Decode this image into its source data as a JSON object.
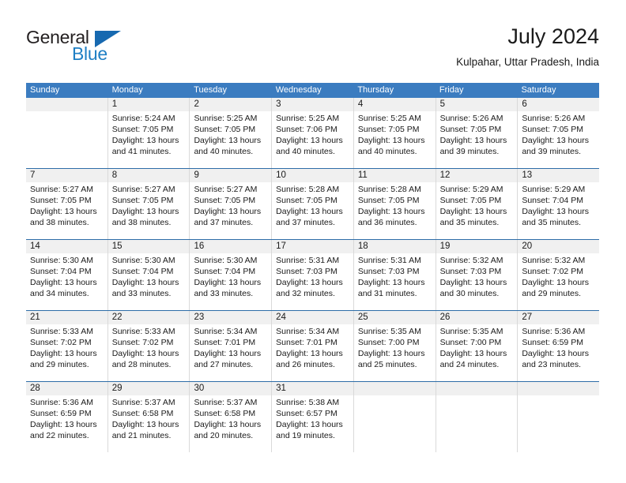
{
  "brand": {
    "name_top": "General",
    "name_bottom": "Blue",
    "color_dark": "#231f20",
    "color_blue": "#1f7fc4"
  },
  "header": {
    "title": "July 2024",
    "subtitle": "Kulpahar, Uttar Pradesh, India"
  },
  "theme": {
    "header_blue": "#3b7cc0",
    "week_divider": "#2e6da8",
    "daynum_band": "#f0f0f0",
    "cell_border": "#d9d9d9"
  },
  "weekdays": [
    "Sunday",
    "Monday",
    "Tuesday",
    "Wednesday",
    "Thursday",
    "Friday",
    "Saturday"
  ],
  "labels": {
    "sunrise_prefix": "Sunrise:",
    "sunset_prefix": "Sunset:",
    "daylight_prefix": "Daylight:"
  },
  "weeks": [
    {
      "days": [
        {
          "num": "",
          "empty": true,
          "sunrise": "",
          "sunset": "",
          "daylight_1": "",
          "daylight_2": ""
        },
        {
          "num": "1",
          "empty": false,
          "sunrise": "Sunrise: 5:24 AM",
          "sunset": "Sunset: 7:05 PM",
          "daylight_1": "Daylight: 13 hours",
          "daylight_2": "and 41 minutes."
        },
        {
          "num": "2",
          "empty": false,
          "sunrise": "Sunrise: 5:25 AM",
          "sunset": "Sunset: 7:05 PM",
          "daylight_1": "Daylight: 13 hours",
          "daylight_2": "and 40 minutes."
        },
        {
          "num": "3",
          "empty": false,
          "sunrise": "Sunrise: 5:25 AM",
          "sunset": "Sunset: 7:06 PM",
          "daylight_1": "Daylight: 13 hours",
          "daylight_2": "and 40 minutes."
        },
        {
          "num": "4",
          "empty": false,
          "sunrise": "Sunrise: 5:25 AM",
          "sunset": "Sunset: 7:05 PM",
          "daylight_1": "Daylight: 13 hours",
          "daylight_2": "and 40 minutes."
        },
        {
          "num": "5",
          "empty": false,
          "sunrise": "Sunrise: 5:26 AM",
          "sunset": "Sunset: 7:05 PM",
          "daylight_1": "Daylight: 13 hours",
          "daylight_2": "and 39 minutes."
        },
        {
          "num": "6",
          "empty": false,
          "sunrise": "Sunrise: 5:26 AM",
          "sunset": "Sunset: 7:05 PM",
          "daylight_1": "Daylight: 13 hours",
          "daylight_2": "and 39 minutes."
        }
      ]
    },
    {
      "days": [
        {
          "num": "7",
          "empty": false,
          "sunrise": "Sunrise: 5:27 AM",
          "sunset": "Sunset: 7:05 PM",
          "daylight_1": "Daylight: 13 hours",
          "daylight_2": "and 38 minutes."
        },
        {
          "num": "8",
          "empty": false,
          "sunrise": "Sunrise: 5:27 AM",
          "sunset": "Sunset: 7:05 PM",
          "daylight_1": "Daylight: 13 hours",
          "daylight_2": "and 38 minutes."
        },
        {
          "num": "9",
          "empty": false,
          "sunrise": "Sunrise: 5:27 AM",
          "sunset": "Sunset: 7:05 PM",
          "daylight_1": "Daylight: 13 hours",
          "daylight_2": "and 37 minutes."
        },
        {
          "num": "10",
          "empty": false,
          "sunrise": "Sunrise: 5:28 AM",
          "sunset": "Sunset: 7:05 PM",
          "daylight_1": "Daylight: 13 hours",
          "daylight_2": "and 37 minutes."
        },
        {
          "num": "11",
          "empty": false,
          "sunrise": "Sunrise: 5:28 AM",
          "sunset": "Sunset: 7:05 PM",
          "daylight_1": "Daylight: 13 hours",
          "daylight_2": "and 36 minutes."
        },
        {
          "num": "12",
          "empty": false,
          "sunrise": "Sunrise: 5:29 AM",
          "sunset": "Sunset: 7:05 PM",
          "daylight_1": "Daylight: 13 hours",
          "daylight_2": "and 35 minutes."
        },
        {
          "num": "13",
          "empty": false,
          "sunrise": "Sunrise: 5:29 AM",
          "sunset": "Sunset: 7:04 PM",
          "daylight_1": "Daylight: 13 hours",
          "daylight_2": "and 35 minutes."
        }
      ]
    },
    {
      "days": [
        {
          "num": "14",
          "empty": false,
          "sunrise": "Sunrise: 5:30 AM",
          "sunset": "Sunset: 7:04 PM",
          "daylight_1": "Daylight: 13 hours",
          "daylight_2": "and 34 minutes."
        },
        {
          "num": "15",
          "empty": false,
          "sunrise": "Sunrise: 5:30 AM",
          "sunset": "Sunset: 7:04 PM",
          "daylight_1": "Daylight: 13 hours",
          "daylight_2": "and 33 minutes."
        },
        {
          "num": "16",
          "empty": false,
          "sunrise": "Sunrise: 5:30 AM",
          "sunset": "Sunset: 7:04 PM",
          "daylight_1": "Daylight: 13 hours",
          "daylight_2": "and 33 minutes."
        },
        {
          "num": "17",
          "empty": false,
          "sunrise": "Sunrise: 5:31 AM",
          "sunset": "Sunset: 7:03 PM",
          "daylight_1": "Daylight: 13 hours",
          "daylight_2": "and 32 minutes."
        },
        {
          "num": "18",
          "empty": false,
          "sunrise": "Sunrise: 5:31 AM",
          "sunset": "Sunset: 7:03 PM",
          "daylight_1": "Daylight: 13 hours",
          "daylight_2": "and 31 minutes."
        },
        {
          "num": "19",
          "empty": false,
          "sunrise": "Sunrise: 5:32 AM",
          "sunset": "Sunset: 7:03 PM",
          "daylight_1": "Daylight: 13 hours",
          "daylight_2": "and 30 minutes."
        },
        {
          "num": "20",
          "empty": false,
          "sunrise": "Sunrise: 5:32 AM",
          "sunset": "Sunset: 7:02 PM",
          "daylight_1": "Daylight: 13 hours",
          "daylight_2": "and 29 minutes."
        }
      ]
    },
    {
      "days": [
        {
          "num": "21",
          "empty": false,
          "sunrise": "Sunrise: 5:33 AM",
          "sunset": "Sunset: 7:02 PM",
          "daylight_1": "Daylight: 13 hours",
          "daylight_2": "and 29 minutes."
        },
        {
          "num": "22",
          "empty": false,
          "sunrise": "Sunrise: 5:33 AM",
          "sunset": "Sunset: 7:02 PM",
          "daylight_1": "Daylight: 13 hours",
          "daylight_2": "and 28 minutes."
        },
        {
          "num": "23",
          "empty": false,
          "sunrise": "Sunrise: 5:34 AM",
          "sunset": "Sunset: 7:01 PM",
          "daylight_1": "Daylight: 13 hours",
          "daylight_2": "and 27 minutes."
        },
        {
          "num": "24",
          "empty": false,
          "sunrise": "Sunrise: 5:34 AM",
          "sunset": "Sunset: 7:01 PM",
          "daylight_1": "Daylight: 13 hours",
          "daylight_2": "and 26 minutes."
        },
        {
          "num": "25",
          "empty": false,
          "sunrise": "Sunrise: 5:35 AM",
          "sunset": "Sunset: 7:00 PM",
          "daylight_1": "Daylight: 13 hours",
          "daylight_2": "and 25 minutes."
        },
        {
          "num": "26",
          "empty": false,
          "sunrise": "Sunrise: 5:35 AM",
          "sunset": "Sunset: 7:00 PM",
          "daylight_1": "Daylight: 13 hours",
          "daylight_2": "and 24 minutes."
        },
        {
          "num": "27",
          "empty": false,
          "sunrise": "Sunrise: 5:36 AM",
          "sunset": "Sunset: 6:59 PM",
          "daylight_1": "Daylight: 13 hours",
          "daylight_2": "and 23 minutes."
        }
      ]
    },
    {
      "days": [
        {
          "num": "28",
          "empty": false,
          "sunrise": "Sunrise: 5:36 AM",
          "sunset": "Sunset: 6:59 PM",
          "daylight_1": "Daylight: 13 hours",
          "daylight_2": "and 22 minutes."
        },
        {
          "num": "29",
          "empty": false,
          "sunrise": "Sunrise: 5:37 AM",
          "sunset": "Sunset: 6:58 PM",
          "daylight_1": "Daylight: 13 hours",
          "daylight_2": "and 21 minutes."
        },
        {
          "num": "30",
          "empty": false,
          "sunrise": "Sunrise: 5:37 AM",
          "sunset": "Sunset: 6:58 PM",
          "daylight_1": "Daylight: 13 hours",
          "daylight_2": "and 20 minutes."
        },
        {
          "num": "31",
          "empty": false,
          "sunrise": "Sunrise: 5:38 AM",
          "sunset": "Sunset: 6:57 PM",
          "daylight_1": "Daylight: 13 hours",
          "daylight_2": "and 19 minutes."
        },
        {
          "num": "",
          "empty": true,
          "sunrise": "",
          "sunset": "",
          "daylight_1": "",
          "daylight_2": ""
        },
        {
          "num": "",
          "empty": true,
          "sunrise": "",
          "sunset": "",
          "daylight_1": "",
          "daylight_2": ""
        },
        {
          "num": "",
          "empty": true,
          "sunrise": "",
          "sunset": "",
          "daylight_1": "",
          "daylight_2": ""
        }
      ]
    }
  ]
}
